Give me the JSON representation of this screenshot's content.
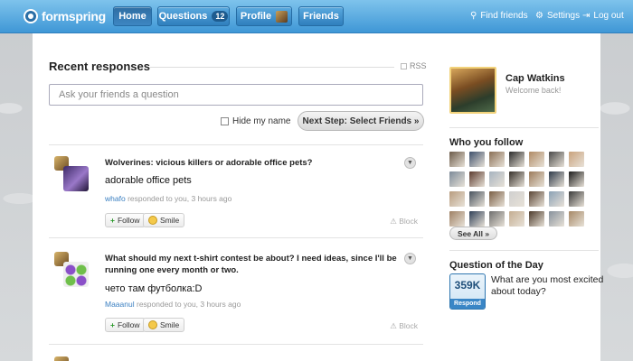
{
  "app": {
    "logo_text": "formspring"
  },
  "nav": {
    "home": "Home",
    "questions": "Questions",
    "questions_count": "12",
    "profile": "Profile",
    "friends": "Friends"
  },
  "top_links": {
    "find_friends": "Find friends",
    "settings": "Settings",
    "logout": "Log out"
  },
  "feed": {
    "title": "Recent responses",
    "rss": "RSS",
    "ask_placeholder": "Ask your friends a question",
    "hide_name": "Hide my name",
    "help": "(?)",
    "next_step": "Next Step: Select Friends »",
    "items": [
      {
        "question": "Wolverines: vicious killers or adorable office pets?",
        "answer": "adorable office pets",
        "user": "whafo",
        "meta": "responded to you, 3 hours ago",
        "follow": "Follow",
        "smile": "Smile",
        "block": "Block"
      },
      {
        "question": "What should my next t-shirt contest be about? I need ideas, since I'll be running one every month or two.",
        "answer": "чето там футболка:D",
        "user": "Maaanul",
        "meta": "responded to you, 3 hours ago",
        "follow": "Follow",
        "smile": "Smile",
        "block": "Block"
      }
    ]
  },
  "sidebar": {
    "name": "Cap Watkins",
    "welcome": "Welcome back!",
    "who_you_follow": "Who you follow",
    "see_all": "See All »",
    "follow_colors": [
      "#6b5a48",
      "#3d4f6b",
      "#8a6f55",
      "#2b2b2b",
      "#b08a64",
      "#4a4a4a",
      "#c9a27c",
      "#7c8a99",
      "#5c3a2e",
      "#a7b3bf",
      "#36302a",
      "#9c7b5b",
      "#2e3a4a",
      "#1c1c1c",
      "#b89c7e",
      "#47525e",
      "#7a5e44",
      "#cfcfcf",
      "#5b4636",
      "#8aa0b5",
      "#3a3a3a",
      "#9e8064",
      "#2f3f57",
      "#6e6e6e",
      "#c4ad91",
      "#4d3b2c",
      "#87919c",
      "#a68866"
    ],
    "qotd_title": "Question of the Day",
    "qotd_count": "359K",
    "qotd_respond": "Respond",
    "qotd_question": "What are you most excited about today?"
  }
}
